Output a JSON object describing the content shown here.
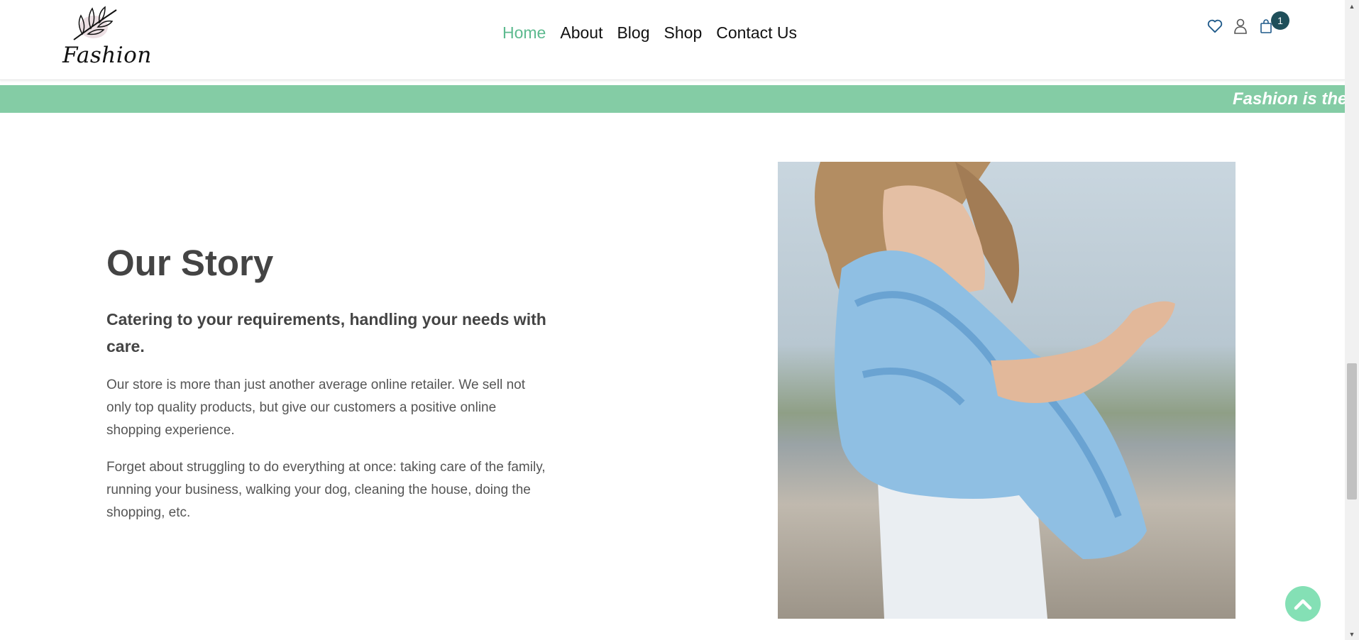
{
  "brand": {
    "logo_text": "Fashion"
  },
  "nav": {
    "items": [
      {
        "label": "Home",
        "active": true
      },
      {
        "label": "About",
        "active": false
      },
      {
        "label": "Blog",
        "active": false
      },
      {
        "label": "Shop",
        "active": false
      },
      {
        "label": "Contact Us",
        "active": false
      }
    ]
  },
  "header_icons": {
    "wishlist": "heart-icon",
    "account": "user-icon",
    "cart": "shopping-bag-icon",
    "cart_count": "1"
  },
  "banner": {
    "text": "Fashion is the"
  },
  "story": {
    "title": "Our Story",
    "subtitle": "Catering to your requirements, handling your needs with care.",
    "paragraphs": [
      "Our store is more than just another average online retailer. We sell not only top quality products, but give our customers a positive online shopping experience.",
      "Forget about struggling to do everything at once: taking care of the family, running your business, walking your dog, cleaning the house, doing the shopping, etc."
    ]
  },
  "colors": {
    "accent": "#5dba8f",
    "banner_bg": "#84cca5",
    "badge_bg": "#1f4f5a",
    "back_to_top": "#84e0b5"
  }
}
